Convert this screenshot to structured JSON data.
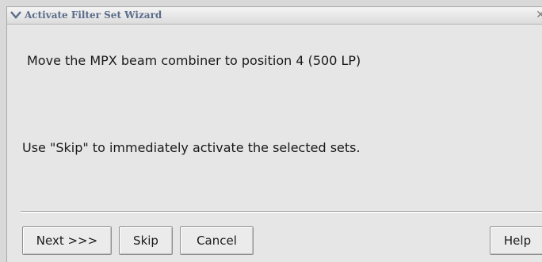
{
  "window": {
    "title": "Activate Filter Set Wizard"
  },
  "content": {
    "instruction": "Move the MPX beam combiner to position 4 (500 LP)",
    "skip_hint": "Use \"Skip\" to immediately activate the selected sets."
  },
  "buttons": {
    "next_label": "Next >>>",
    "skip_label": "Skip",
    "cancel_label": "Cancel",
    "help_label": "Help"
  },
  "icons": {
    "window_menu": "chevron-down-icon",
    "window_close": "close-icon"
  },
  "colors": {
    "title_text": "#5b6c8a",
    "window_background": "#e6e6e6"
  }
}
